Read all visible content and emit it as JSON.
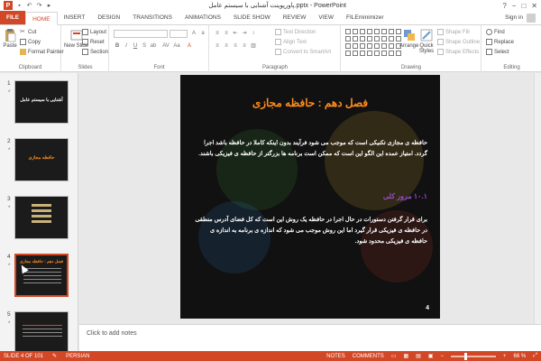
{
  "titlebar": {
    "title": "پاورپوینت آشنایی با سیستم عامل.pptx - PowerPoint",
    "logo_letter": "P",
    "window_controls": [
      "?",
      "−",
      "□",
      "✕"
    ]
  },
  "tabs": {
    "items": [
      "FILE",
      "HOME",
      "INSERT",
      "DESIGN",
      "TRANSITIONS",
      "ANIMATIONS",
      "SLIDE SHOW",
      "REVIEW",
      "VIEW",
      "FILEminimizer"
    ],
    "active": "HOME",
    "sign_in": "Sign in"
  },
  "ribbon": {
    "clipboard": {
      "paste": "Paste",
      "cut": "Cut",
      "copy": "Copy",
      "format_painter": "Format Painter",
      "label": "Clipboard"
    },
    "slides": {
      "new_slide": "New Slide",
      "layout": "Layout",
      "reset": "Reset",
      "section": "Section",
      "label": "Slides"
    },
    "font": {
      "label": "Font"
    },
    "paragraph": {
      "text_direction": "Text Direction",
      "align_text": "Align Text",
      "convert_smartart": "Convert to SmartArt",
      "label": "Paragraph"
    },
    "drawing": {
      "arrange": "Arrange",
      "quick_styles": "Quick Styles",
      "shape_fill": "Shape Fill",
      "shape_outline": "Shape Outline",
      "shape_effects": "Shape Effects",
      "label": "Drawing"
    },
    "editing": {
      "find": "Find",
      "replace": "Replace",
      "select": "Select",
      "label": "Editing"
    }
  },
  "thumbnails": [
    {
      "num": "1",
      "star": "*",
      "title": "آشنایی با سیستم عامل"
    },
    {
      "num": "2",
      "star": "*",
      "title": "حافظه مجازی"
    },
    {
      "num": "3",
      "star": "*",
      "title": ""
    },
    {
      "num": "4",
      "star": "*",
      "title": "فصل دهم : حافظه مجازی"
    },
    {
      "num": "5",
      "star": "*",
      "title": ""
    }
  ],
  "slide": {
    "heading": "فصل دهم : حافظه مجازی",
    "para1": "حافظه ی مجازی تکنیکی است که موجب می شود فرآیند بدون اینکه کاملا در حافظه باشد اجرا گردد. امتیاز عمده این الگو این است که ممکن است برنامه ها بزرگتر از حافظه ی فیزیکی باشند.",
    "subheading": "۱۰.۱ مرور کلی",
    "para2": "برای قرار گرفتن دستورات در حال اجرا در حافظه یک روش این است که کل فضای آدرس منطقی در حافظه ی فیزیکی قرار گیرد اما این روش موجب می شود که اندازه ی برنامه به اندازه ی حافظه ی فیزیکی محدود شود.",
    "page_number": "4"
  },
  "notes": {
    "placeholder": "Click to add notes"
  },
  "statusbar": {
    "slide_info": "SLIDE 4 OF 101",
    "language": "PERSIAN",
    "notes": "NOTES",
    "comments": "COMMENTS",
    "zoom": "66 %",
    "zoom_level": 0.66
  }
}
